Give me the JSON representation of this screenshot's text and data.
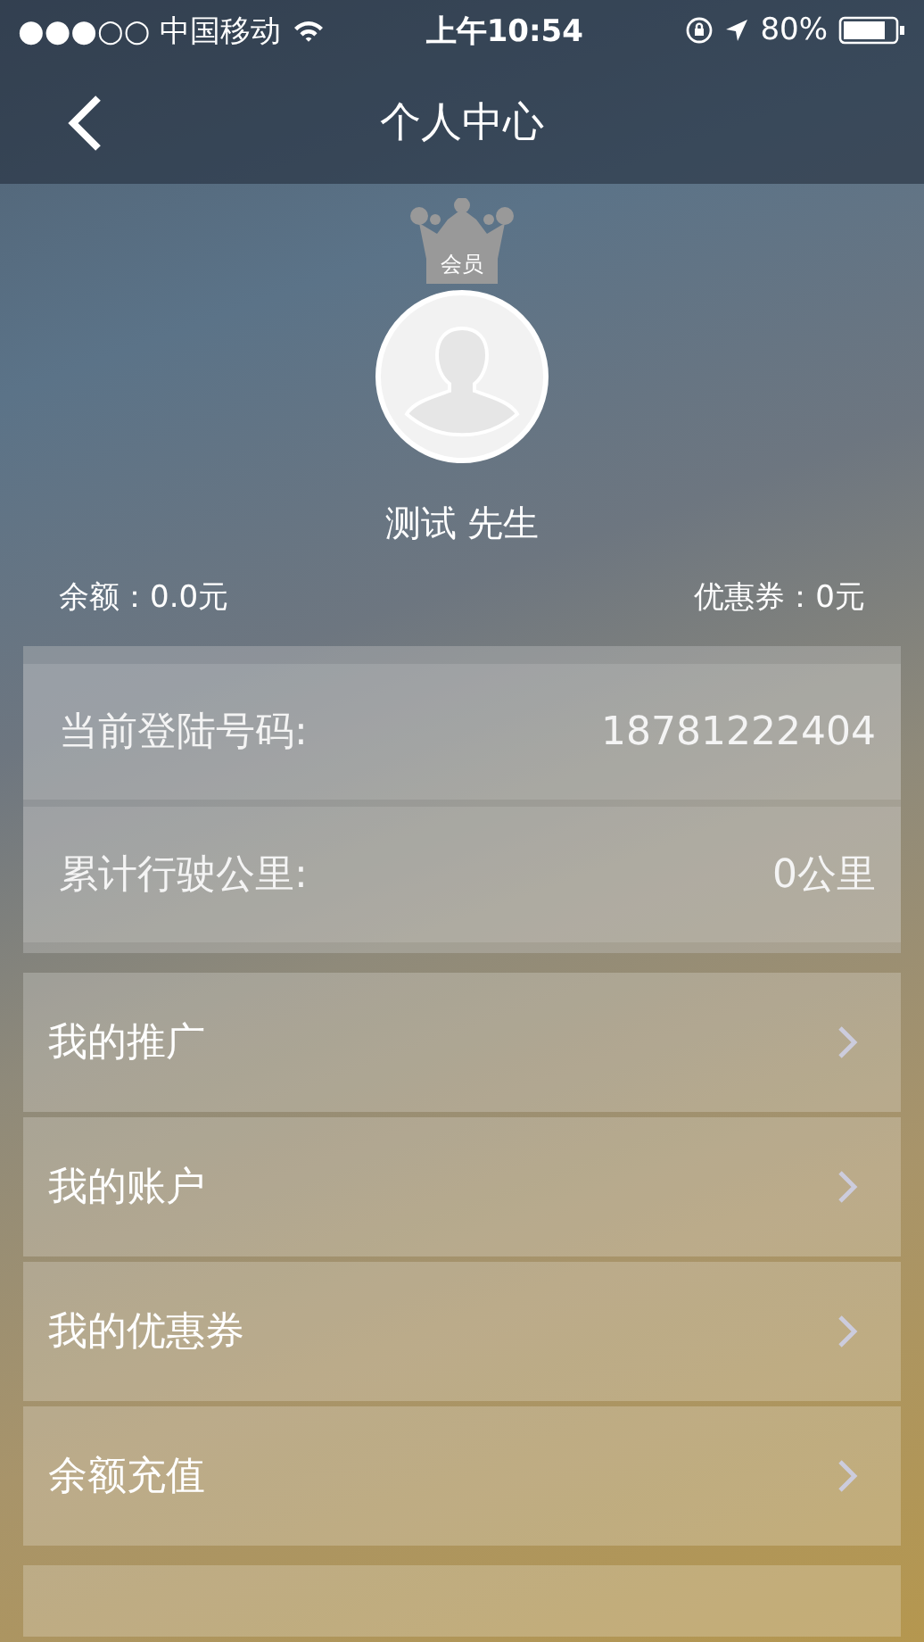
{
  "status_bar": {
    "carrier": "●●●○○ 中国移动",
    "time": "上午10:54",
    "battery": "80%"
  },
  "nav": {
    "title": "个人中心"
  },
  "profile": {
    "badge": "会员",
    "name": "测试 先生",
    "balance": "余额：0.0元",
    "coupons": "优惠券：0元"
  },
  "info": [
    {
      "label": "当前登陆号码:",
      "value": "18781222404"
    },
    {
      "label": "累计行驶公里:",
      "value": "0公里"
    }
  ],
  "menu_groups": [
    [
      {
        "label": "我的推广"
      },
      {
        "label": "我的账户"
      },
      {
        "label": "我的优惠券"
      },
      {
        "label": "余额充值"
      }
    ]
  ]
}
